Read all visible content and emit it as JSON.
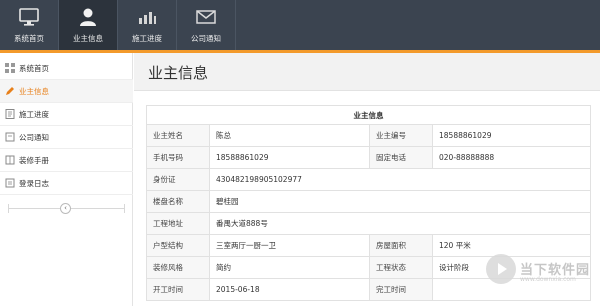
{
  "topnav": {
    "items": [
      {
        "label": "系统首页",
        "icon": "monitor-icon"
      },
      {
        "label": "业主信息",
        "icon": "user-icon"
      },
      {
        "label": "施工进度",
        "icon": "bar-chart-icon"
      },
      {
        "label": "公司通知",
        "icon": "envelope-icon"
      }
    ],
    "active_index": 1
  },
  "sidebar": {
    "items": [
      {
        "label": "系统首页",
        "icon": "grid-icon"
      },
      {
        "label": "业主信息",
        "icon": "pencil-icon"
      },
      {
        "label": "施工进度",
        "icon": "document-icon"
      },
      {
        "label": "公司通知",
        "icon": "bell-icon"
      },
      {
        "label": "装修手册",
        "icon": "book-icon"
      },
      {
        "label": "登录日志",
        "icon": "log-icon"
      }
    ],
    "active_index": 1,
    "collapse_symbol": "‹"
  },
  "main": {
    "page_title": "业主信息",
    "table": {
      "title": "业主信息",
      "rows": [
        {
          "l1": "业主姓名",
          "v1": "陈总",
          "l2": "业主编号",
          "v2": "18588861029"
        },
        {
          "l1": "手机号码",
          "v1": "18588861029",
          "l2": "固定电话",
          "v2": "020-88888888"
        },
        {
          "l1": "身份证",
          "v1": "430482198905102977",
          "l2": "",
          "v2": ""
        },
        {
          "l1": "楼盘名称",
          "v1": "碧桂园",
          "l2": "",
          "v2": ""
        },
        {
          "l1": "工程地址",
          "v1": "番禺大道888号",
          "l2": "",
          "v2": ""
        },
        {
          "l1": "户型结构",
          "v1": "三室两厅一厨一卫",
          "l2": "房屋面积",
          "v2": "120 平米"
        },
        {
          "l1": "装修风格",
          "v1": "简约",
          "l2": "工程状态",
          "v2": "设计阶段"
        },
        {
          "l1": "开工时间",
          "v1": "2015-06-18",
          "l2": "完工时间",
          "v2": ""
        }
      ]
    }
  },
  "watermark": {
    "text": "当下软件园",
    "url": "www.downxia.com"
  },
  "colors": {
    "topbar": "#3b4450",
    "topbar_active": "#2c333c",
    "accent": "#f39a2b",
    "active_text": "#e8801a"
  }
}
